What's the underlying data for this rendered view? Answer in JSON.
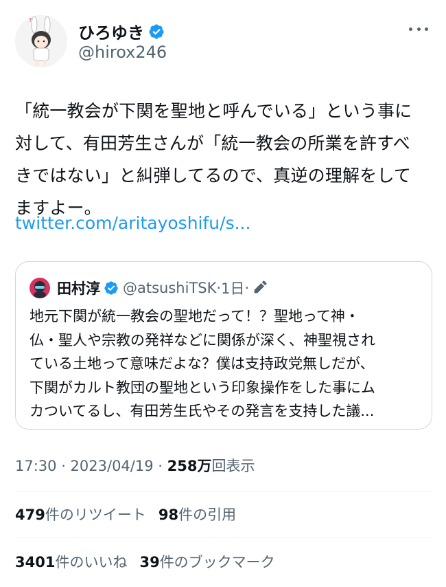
{
  "tweet": {
    "author": {
      "display_name": "ひろゆき",
      "handle": "@hirox246",
      "verified_icon": "verified-badge-icon",
      "avatar_icon": "rabbit-ears-character-avatar"
    },
    "text_lines": [
      "「統一教会が下関を聖地と呼んでいる」という事に",
      "対して、有田芳生さんが「統一教会の所業を許すべ",
      "きではない」と糾弾してるので、真逆の理解をして",
      "ますよー。"
    ],
    "link_text": "twitter.com/aritayoshifu/s...",
    "quoted_tweet": {
      "author_name": "田村淳",
      "handle": "@atsushiTSK",
      "separator1": "·",
      "time": "1日",
      "separator2": "·",
      "edit_icon": "pencil-icon",
      "text_lines": [
        "地元下関が統一教会の聖地だって！？聖地って神・",
        "仏・聖人や宗教の発祥などに関係が深く、神聖視され",
        "ている土地って意味だよな？僕は支持政党無しだが、",
        "下関がカルト教団の聖地という印象操作をした事にム",
        "カついてるし、有田芳生氏やその発言を支持した議..."
      ]
    },
    "timestamp": "17:30 · 2023/04/19 · ",
    "views_count": "258万",
    "views_label": "回表示",
    "stats": {
      "retweets_count": "479",
      "retweets_label": "件のリツイート",
      "quotes_count": "98",
      "quotes_label": "件の引用",
      "likes_count": "3401",
      "likes_label": "件のいいね",
      "bookmarks_count": "39",
      "bookmarks_label": "件のブックマーク"
    },
    "colors": {
      "link": "#1d9bf0",
      "verified": "#1d9bf0",
      "secondary_text": "#536471",
      "border": "#cfd9de"
    }
  }
}
